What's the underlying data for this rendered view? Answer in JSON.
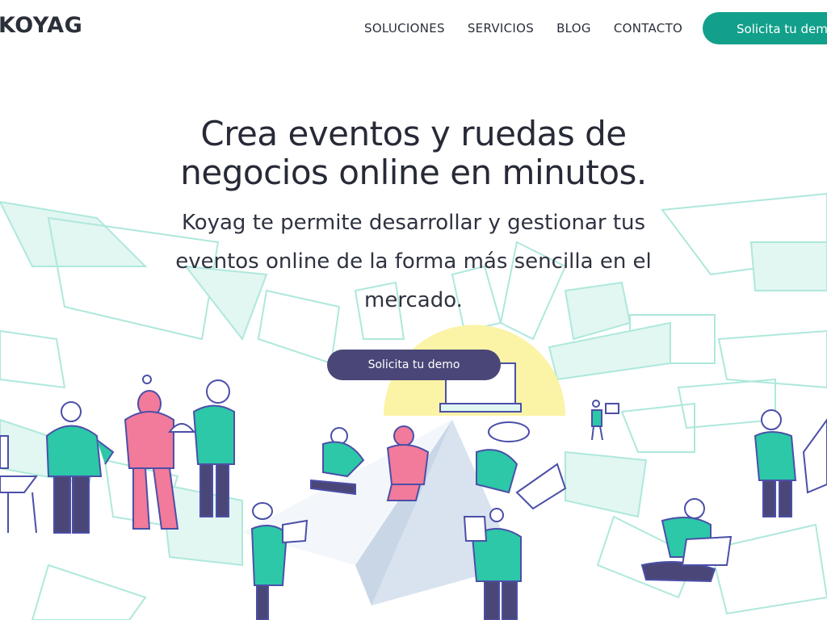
{
  "brand": {
    "logo_text": "KOYAG"
  },
  "nav": {
    "items": [
      {
        "label": "SOLUCIONES"
      },
      {
        "label": "SERVICIOS"
      },
      {
        "label": "BLOG"
      },
      {
        "label": "CONTACTO"
      }
    ],
    "cta_label": "Solicita tu demo"
  },
  "hero": {
    "title_line1": "Crea eventos y ruedas de",
    "title_line2": "negocios online en minutos.",
    "subtitle": "Koyag te permite desarrollar y gestionar tus eventos online de la forma más sencilla en el mercado.",
    "cta_label": "Solicita tu demo"
  },
  "colors": {
    "teal_accent": "#12a08b",
    "purple_button": "#4a4778",
    "text_dark": "#272a36",
    "illustration_teal": "#2cc8a8",
    "illustration_pink": "#f27a9a",
    "illustration_yellow": "#fbf3a6",
    "illustration_outline": "#4b4fa8"
  },
  "illustration": {
    "icon": "people-paper-plane-illustration"
  }
}
